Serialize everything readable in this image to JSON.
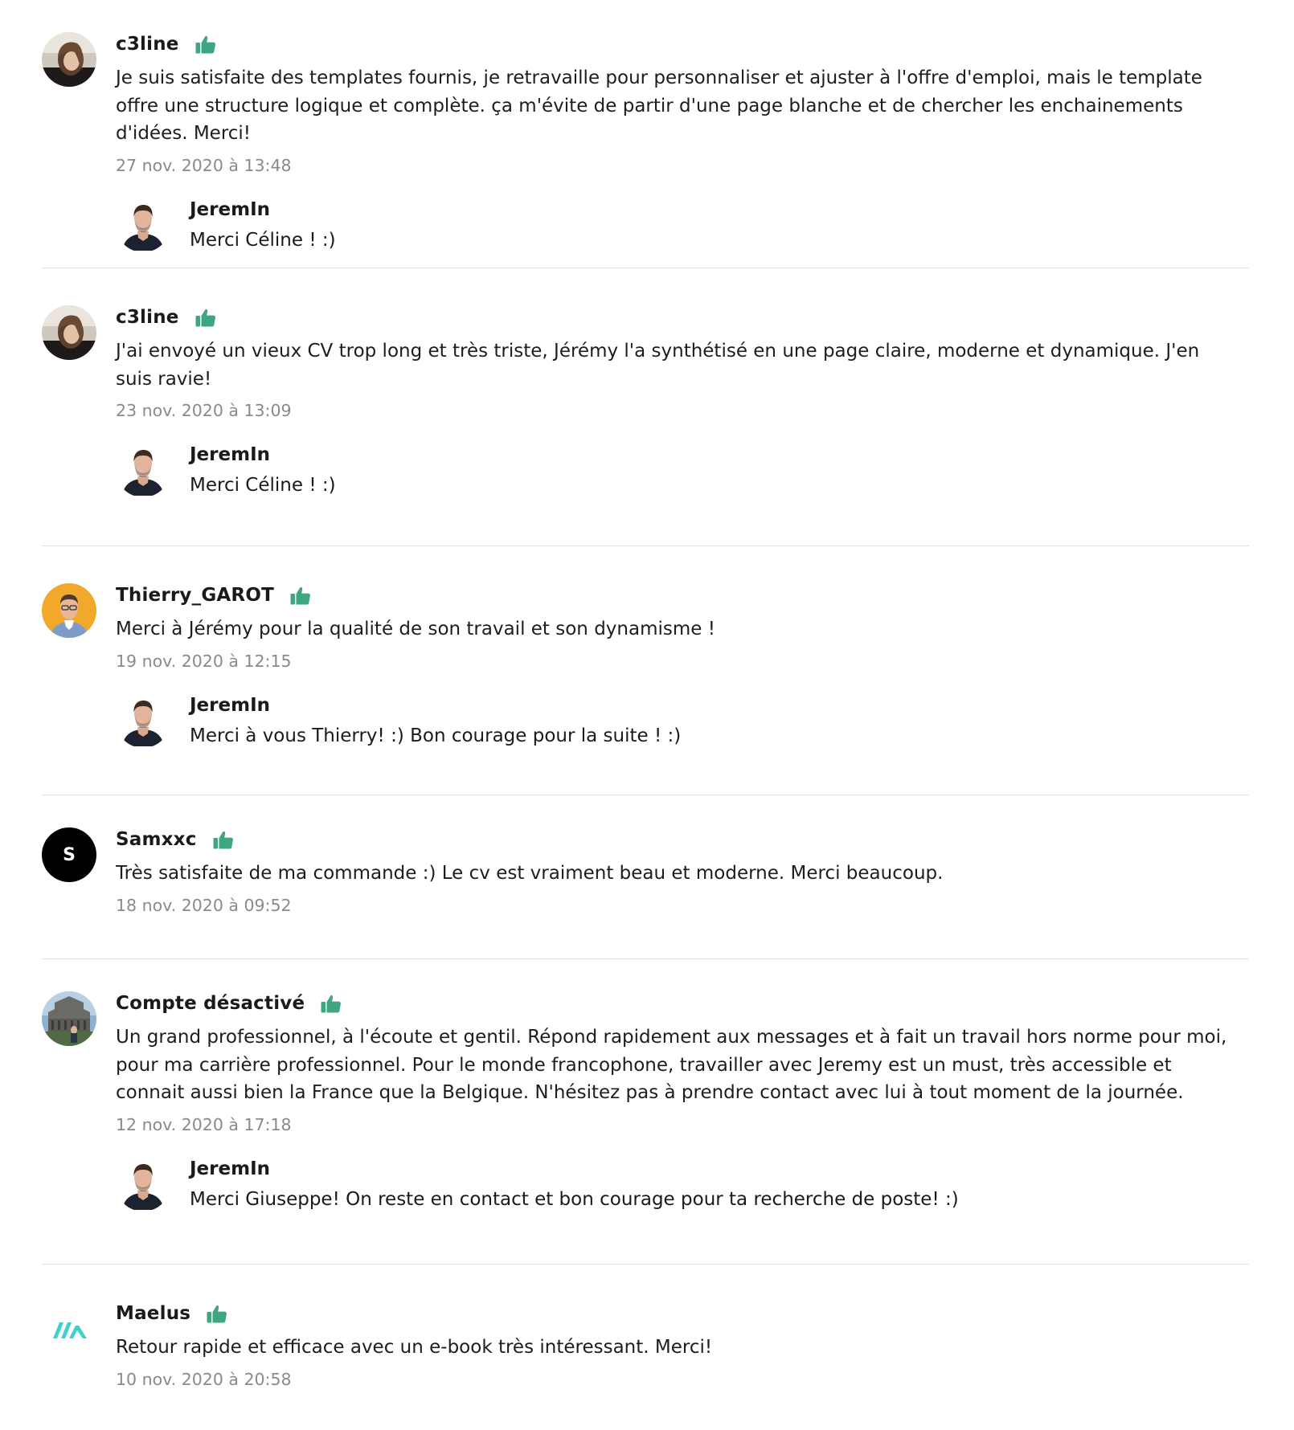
{
  "colors": {
    "thumb_green": "#3fa77f",
    "date_gray": "#8a8a8a",
    "divider": "#e2e2e2",
    "avatar_thierry_bg": "#f2a82b",
    "avatar_samxxc_bg": "#000000",
    "maelus_logo_teal": "#3fd0c9"
  },
  "reviews": [
    {
      "username": "c3line",
      "icon": "thumbs-up-icon",
      "text": "Je suis satisfaite des templates fournis, je retravaille pour personnaliser et ajuster à l'offre d'emploi, mais le template offre une structure logique et complète. ça m'évite de partir d'une page blanche et de chercher les enchainements d'idées. Merci!",
      "date": "27 nov. 2020 à 13:48",
      "reply": {
        "username": "JeremIn",
        "text": "Merci Céline ! :)"
      }
    },
    {
      "username": "c3line",
      "icon": "thumbs-up-icon",
      "text": "J'ai envoyé un vieux CV trop long et très triste, Jérémy l'a synthétisé en une page claire, moderne et dynamique. J'en suis ravie!",
      "date": "23 nov. 2020 à 13:09",
      "reply": {
        "username": "JeremIn",
        "text": "Merci Céline ! :)"
      }
    },
    {
      "username": "Thierry_GAROT",
      "icon": "thumbs-up-icon",
      "text": "Merci à Jérémy pour la qualité de son travail et son dynamisme !",
      "date": "19 nov. 2020 à 12:15",
      "reply": {
        "username": "JeremIn",
        "text": "Merci à vous Thierry! :) Bon courage pour la suite ! :)"
      }
    },
    {
      "username": "Samxxc",
      "avatar_letter": "S",
      "icon": "thumbs-up-icon",
      "text": "Très satisfaite de ma commande :) Le cv est vraiment beau et moderne. Merci beaucoup.",
      "date": "18 nov. 2020 à 09:52"
    },
    {
      "username": "Compte désactivé",
      "icon": "thumbs-up-icon",
      "text": "Un grand professionnel, à l'écoute et gentil. Répond rapidement aux messages et à fait un travail hors norme pour moi, pour ma carrière professionnel. Pour le monde francophone, travailler avec Jeremy est un must, très accessible et connait aussi bien la France que la Belgique. N'hésitez pas à prendre contact avec lui à tout moment de la journée.",
      "date": "12 nov. 2020 à 17:18",
      "reply": {
        "username": "JeremIn",
        "text": "Merci Giuseppe! On reste en contact et bon courage pour ta recherche de poste! :)"
      }
    },
    {
      "username": "Maelus",
      "icon": "thumbs-up-icon",
      "text": "Retour rapide et efficace avec un e-book très intéressant. Merci!",
      "date": "10 nov. 2020 à 20:58"
    }
  ]
}
